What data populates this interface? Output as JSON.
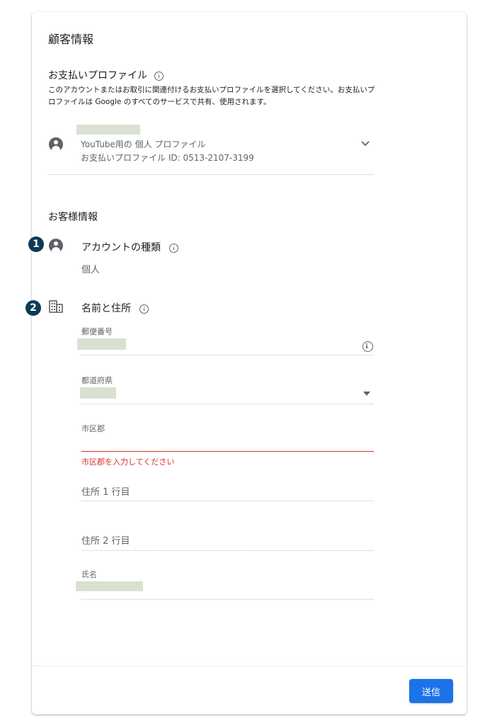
{
  "page": {
    "title": "顧客情報"
  },
  "payment_profile": {
    "heading": "お支払いプロファイル",
    "description": "このアカウントまたはお取引に関連付けるお支払いプロファイルを選択してください。お支払いプロファイルは Google のすべてのサービスで共有、使用されます。",
    "profile_line": "YouTube用の 個人 プロファイル",
    "profile_id": "お支払いプロファイル ID: 0513-2107-3199"
  },
  "customer_info": {
    "heading": "お客様情報",
    "account_type": {
      "badge": "1",
      "heading": "アカウントの種類",
      "value": "個人"
    },
    "name_address": {
      "badge": "2",
      "heading": "名前と住所",
      "fields": {
        "postal_code_label": "郵便番号",
        "prefecture_label": "都道府県",
        "city_label": "市区郡",
        "city_error": "市区郡を入力してください",
        "address1_placeholder": "住所 1 行目",
        "address2_placeholder": "住所 2 行目",
        "name_label": "氏名"
      }
    }
  },
  "footer": {
    "submit_label": "送信"
  },
  "colors": {
    "primary": "#1a73e8",
    "error": "#d93025",
    "badge": "#0d3a56"
  },
  "icons": [
    "info-icon",
    "person-icon",
    "chevron-down-icon",
    "building-icon",
    "dropdown-arrow-icon"
  ]
}
